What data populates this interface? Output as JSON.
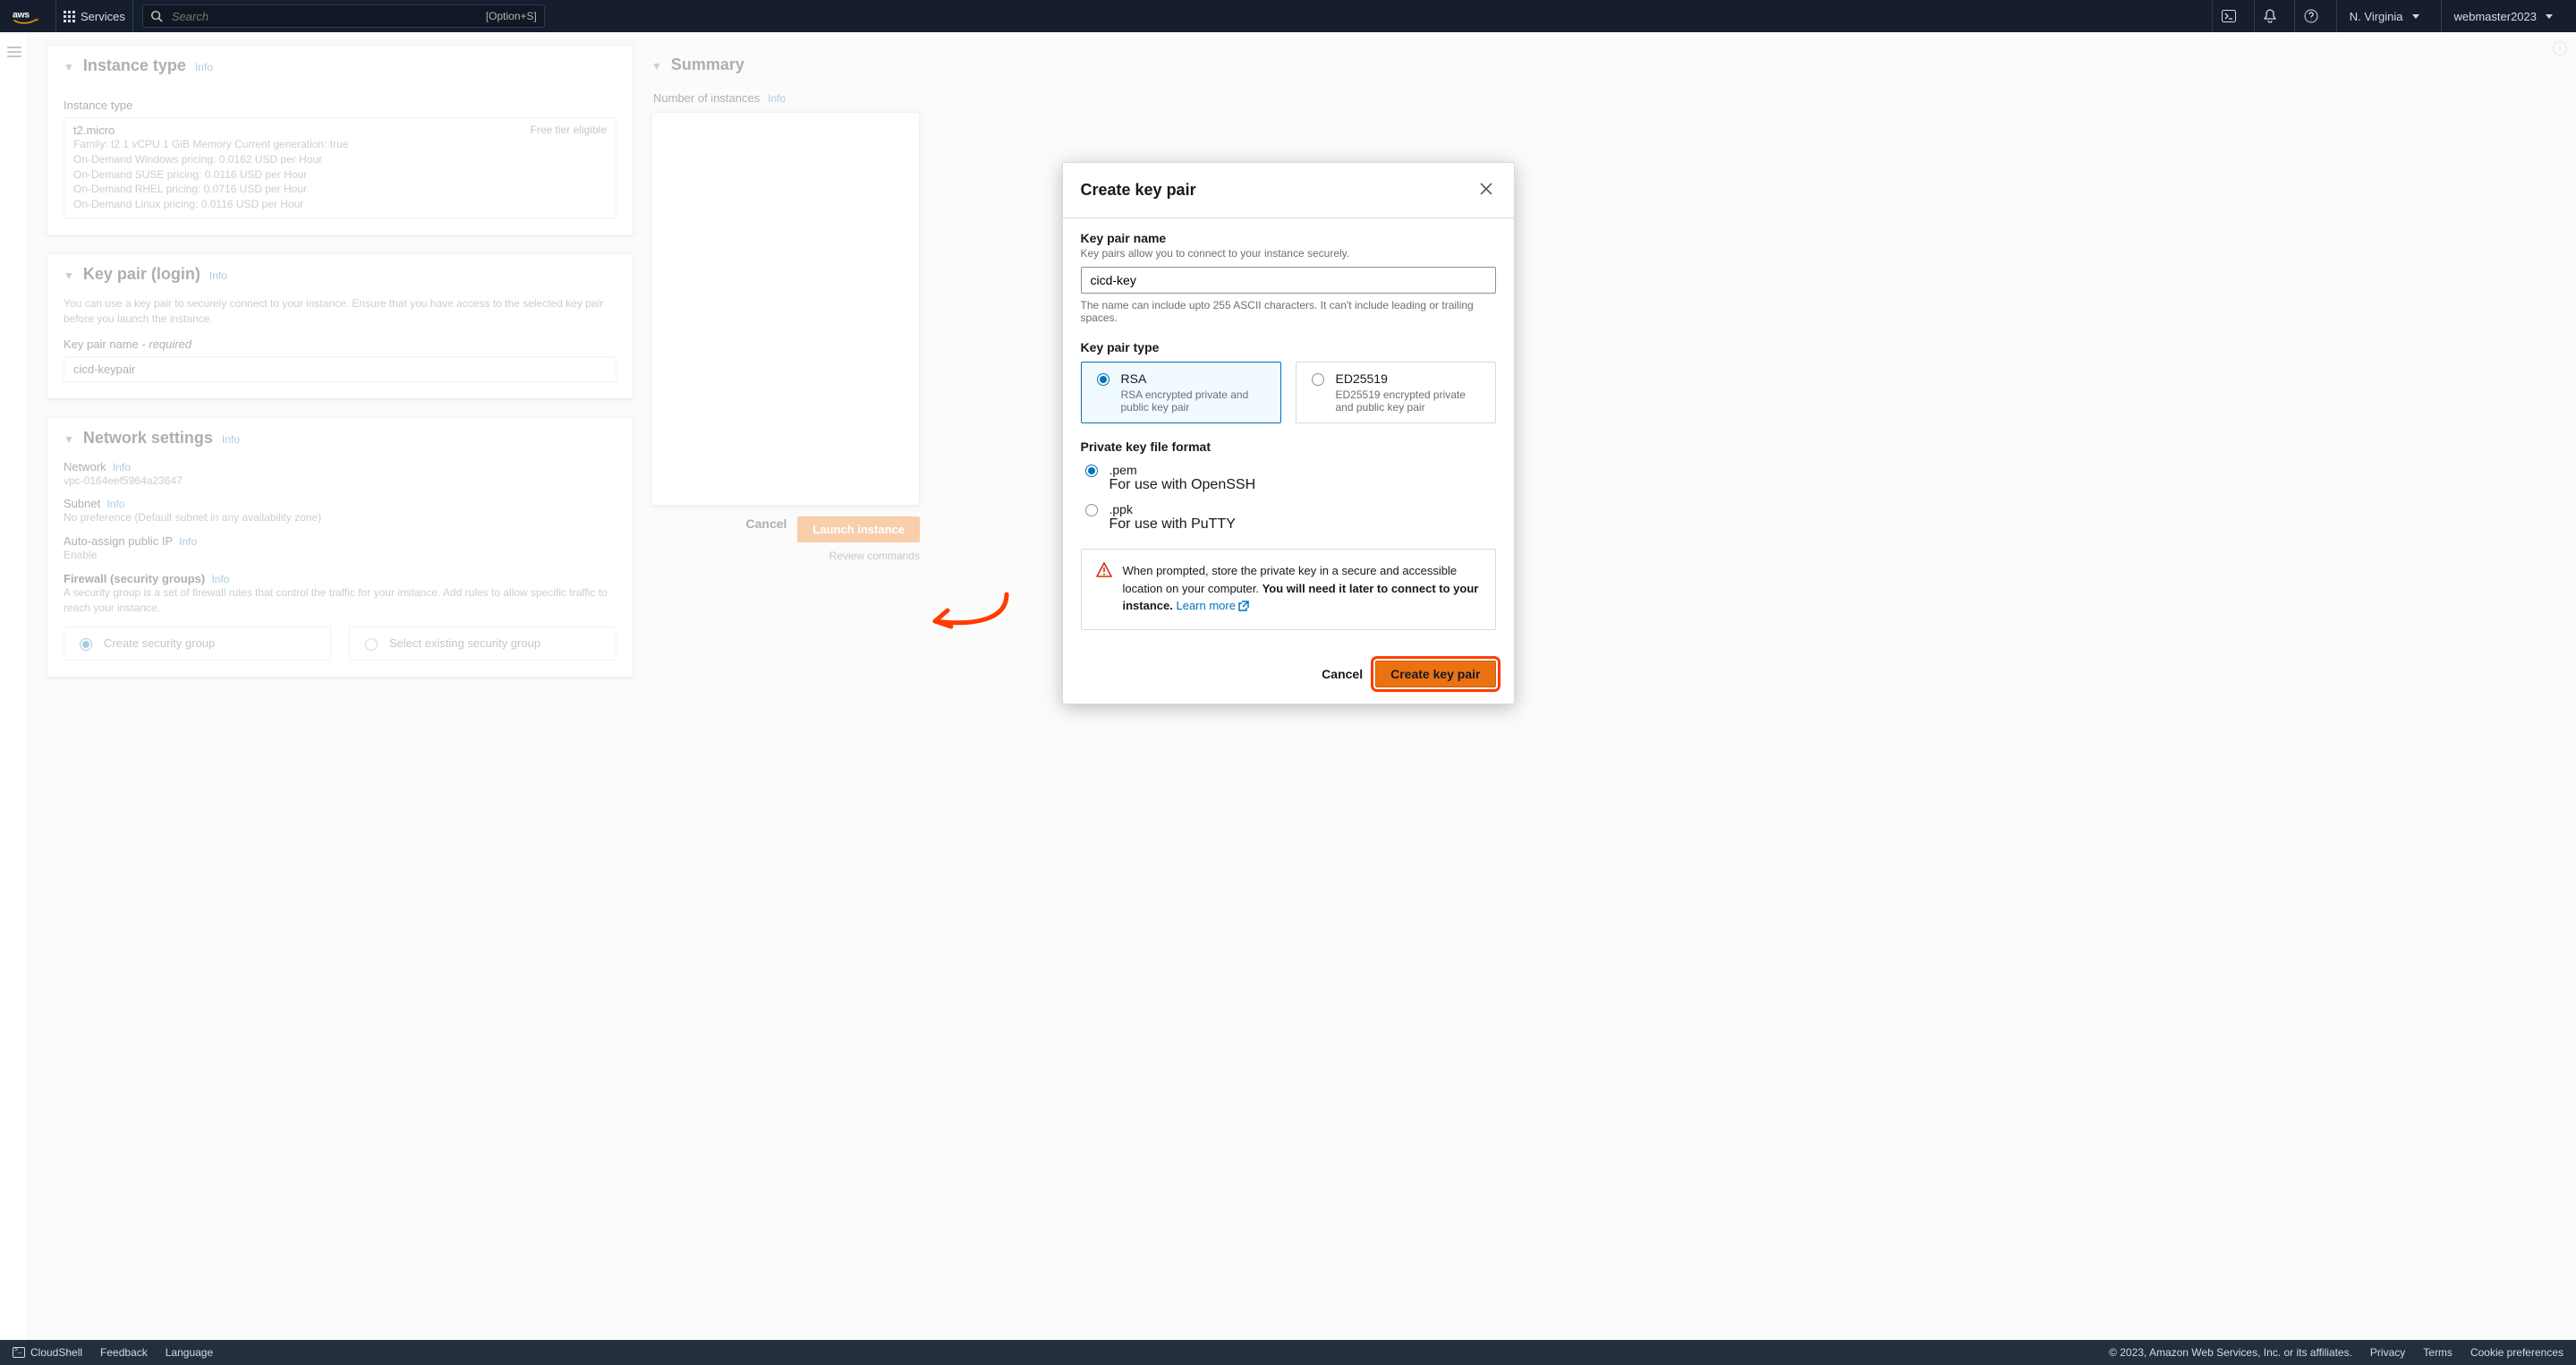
{
  "nav": {
    "services": "Services",
    "search_placeholder": "Search",
    "search_shortcut": "[Option+S]",
    "region": "N. Virginia",
    "account": "webmaster2023"
  },
  "bg": {
    "instance_type_header": "Instance type",
    "info": "Info",
    "instance_type_label": "Instance type",
    "instance_type_value": "t2.micro",
    "free_tier": "Free tier eligible",
    "line1": "Family: t2   1 vCPU   1 GiB Memory   Current generation: true",
    "line2": "On-Demand Windows pricing: 0.0162 USD per Hour",
    "line3": "On-Demand SUSE pricing: 0.0116 USD per Hour",
    "line4": "On-Demand RHEL pricing: 0.0716 USD per Hour",
    "line5": "On-Demand Linux pricing: 0.0116 USD per Hour",
    "keypair_header": "Key pair (login)",
    "keypair_desc": "You can use a key pair to securely connect to your instance. Ensure that you have access to the selected key pair before you launch the instance.",
    "keypair_name_label": "Key pair name - ",
    "keypair_required": "required",
    "keypair_value": "cicd-keypair",
    "network_header": "Network settings",
    "network_label": "Network",
    "network_value": "vpc-0164eef5964a23647",
    "subnet_label": "Subnet",
    "subnet_value": "No preference (Default subnet in any availability zone)",
    "autoip_label": "Auto-assign public IP",
    "autoip_value": "Enable",
    "firewall_label": "Firewall (security groups)",
    "firewall_desc": "A security group is a set of firewall rules that control the traffic for your instance. Add rules to allow specific traffic to reach your instance.",
    "sg_create": "Create security group",
    "sg_select": "Select existing security group",
    "summary_header": "Summary",
    "num_instances_label": "Number of instances",
    "cancel": "Cancel",
    "launch": "Launch instance",
    "review": "Review commands"
  },
  "modal": {
    "title": "Create key pair",
    "name_label": "Key pair name",
    "name_sub": "Key pairs allow you to connect to your instance securely.",
    "name_value": "cicd-key",
    "name_hint": "The name can include upto 255 ASCII characters. It can't include leading or trailing spaces.",
    "type_label": "Key pair type",
    "rsa_title": "RSA",
    "rsa_sub": "RSA encrypted private and public key pair",
    "ed_title": "ED25519",
    "ed_sub": "ED25519 encrypted private and public key pair",
    "fmt_label": "Private key file format",
    "pem_title": ".pem",
    "pem_sub": "For use with OpenSSH",
    "ppk_title": ".ppk",
    "ppk_sub": "For use with PuTTY",
    "alert_a": "When prompted, store the private key in a secure and accessible location on your computer. ",
    "alert_b": "You will need it later to connect to your instance.",
    "learn_more": "Learn more",
    "cancel": "Cancel",
    "create": "Create key pair"
  },
  "bottom": {
    "cloudshell": "CloudShell",
    "feedback": "Feedback",
    "language": "Language",
    "copyright": "© 2023, Amazon Web Services, Inc. or its affiliates.",
    "privacy": "Privacy",
    "terms": "Terms",
    "cookies": "Cookie preferences"
  }
}
